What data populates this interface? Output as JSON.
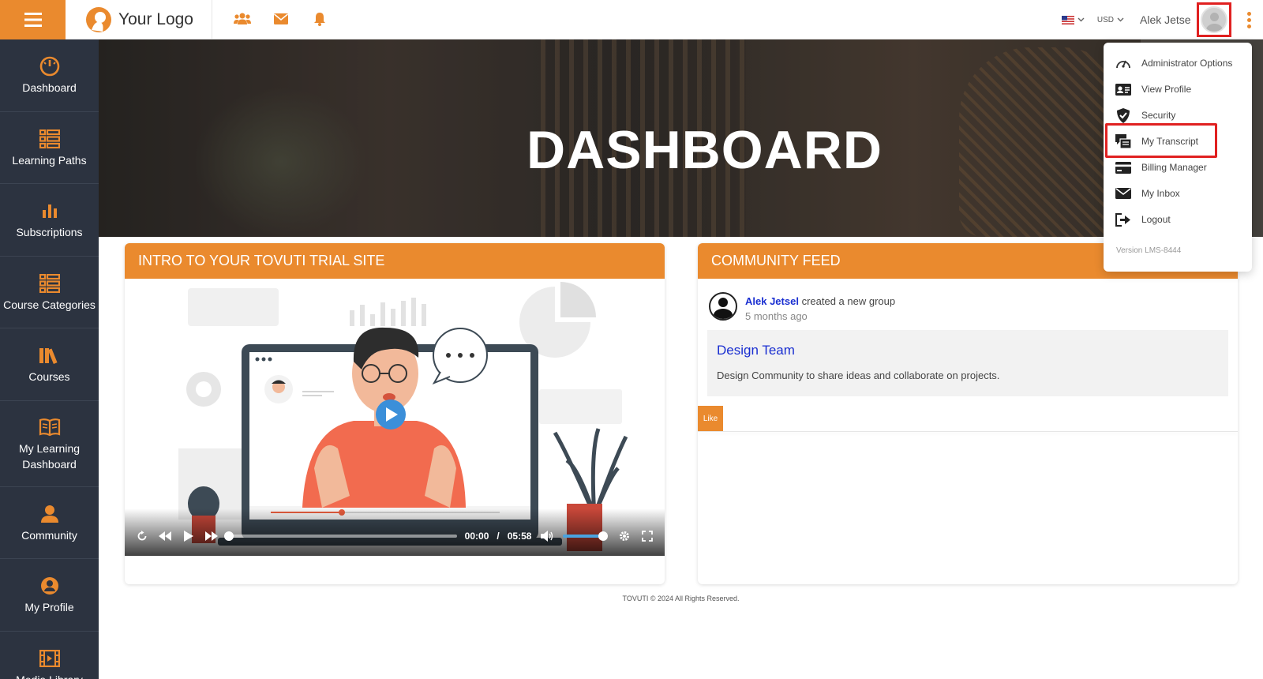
{
  "brand": {
    "logo_text": "Your Logo",
    "accent": "#ea8a2e",
    "sidebar_bg": "#2c3340",
    "link_color": "#1a2fd1"
  },
  "header": {
    "icons": [
      "users-icon",
      "envelope-icon",
      "bell-icon"
    ],
    "language": "en-US",
    "currency": "USD",
    "user_name": "Alek Jetse"
  },
  "sidebar": {
    "items": [
      {
        "label": "Dashboard",
        "icon": "gauge-icon"
      },
      {
        "label": "Learning Paths",
        "icon": "list-icon"
      },
      {
        "label": "Subscriptions",
        "icon": "bar-chart-icon"
      },
      {
        "label": "Course Categories",
        "icon": "list-icon"
      },
      {
        "label": "Courses",
        "icon": "books-icon"
      },
      {
        "label": "My Learning Dashboard",
        "icon": "open-book-icon"
      },
      {
        "label": "Community",
        "icon": "community-icon"
      },
      {
        "label": "My Profile",
        "icon": "user-circle-icon"
      },
      {
        "label": "Media Library",
        "icon": "film-icon"
      }
    ]
  },
  "hero": {
    "title": "DASHBOARD"
  },
  "intro_card": {
    "title": "INTRO TO YOUR TOVUTI TRIAL SITE",
    "player": {
      "current_time": "00:00",
      "separator": "/",
      "duration": "05:58",
      "progress": 0.0,
      "volume": 1.0
    }
  },
  "community_feed": {
    "title": "COMMUNITY FEED",
    "posts": [
      {
        "author": "Alek Jetsel",
        "action": "created a new group",
        "time_ago": "5 months ago",
        "group_title": "Design Team",
        "group_description": "Design Community to share ideas and collaborate on projects.",
        "like_label": "Like"
      }
    ]
  },
  "user_menu": {
    "items": [
      {
        "label": "Administrator Options",
        "icon": "gauge-icon"
      },
      {
        "label": "View Profile",
        "icon": "id-card-icon"
      },
      {
        "label": "Security",
        "icon": "shield-icon"
      },
      {
        "label": "My Transcript",
        "icon": "transcript-icon",
        "highlighted": true
      },
      {
        "label": "Billing Manager",
        "icon": "credit-card-icon"
      },
      {
        "label": "My Inbox",
        "icon": "envelope-icon"
      },
      {
        "label": "Logout",
        "icon": "logout-icon"
      }
    ],
    "version": "Version LMS-8444"
  },
  "footer": {
    "text": "TOVUTI © 2024 All Rights Reserved."
  }
}
